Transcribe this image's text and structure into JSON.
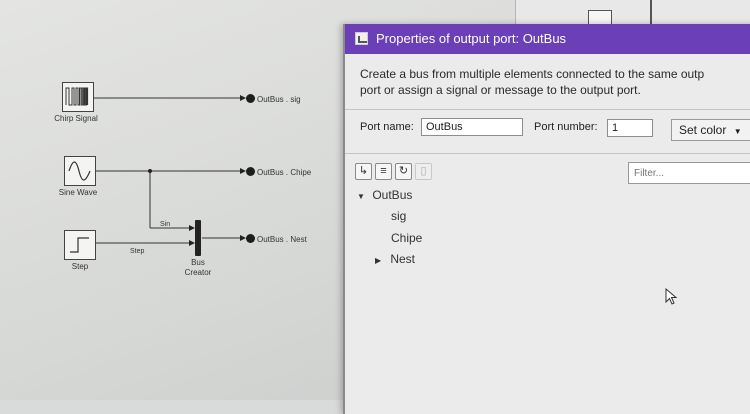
{
  "model": {
    "blocks": {
      "chirp": {
        "label": "Chirp Signal"
      },
      "sine": {
        "label": "Sine Wave"
      },
      "step": {
        "label": "Step"
      },
      "bus_creator": {
        "label": "Bus\nCreator"
      }
    },
    "outports": [
      {
        "label": "OutBus . sig"
      },
      {
        "label": "OutBus . Chipe"
      },
      {
        "label": "OutBus . Nest"
      }
    ],
    "signal_labels": {
      "sin": "Sin",
      "step": "Step"
    }
  },
  "dialog": {
    "title": "Properties of output port: OutBus",
    "description_line1": "Create a bus from multiple elements connected to the same outp",
    "description_line2": "port or assign a signal or message to the output port.",
    "port_name_label": "Port name:",
    "port_name_value": "OutBus",
    "port_number_label": "Port number:",
    "port_number_value": "1",
    "set_color_label": "Set color",
    "filter_placeholder": "Filter...",
    "toolbar_icons": [
      "add-element-icon",
      "add-bus-element-icon",
      "refresh-icon",
      "delete-icon"
    ],
    "tree": {
      "root": "OutBus",
      "children": [
        "sig",
        "Chipe",
        "Nest"
      ]
    }
  }
}
